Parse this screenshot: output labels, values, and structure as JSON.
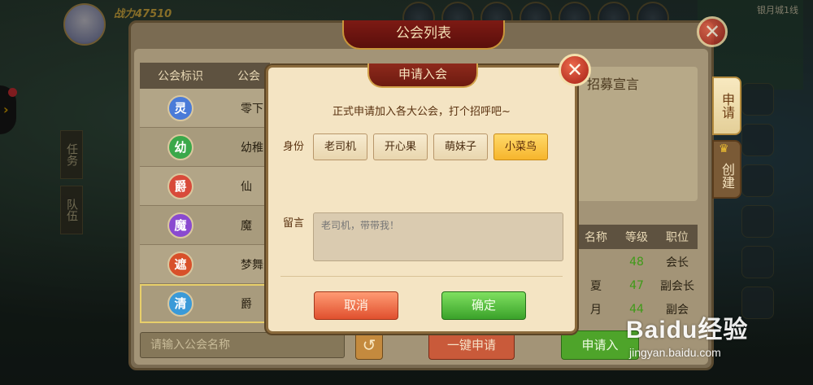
{
  "hud": {
    "power": "战力47510",
    "map_label": "银月城1线"
  },
  "side_tabs": [
    "任务",
    "队伍"
  ],
  "guild_panel": {
    "title": "公会列表",
    "columns": [
      "公会标识",
      "公会"
    ],
    "rows": [
      {
        "emblem": "灵",
        "color": "#4a7bd8",
        "name": "零下"
      },
      {
        "emblem": "幼",
        "color": "#3aa84a",
        "name": "幼稚"
      },
      {
        "emblem": "爵",
        "color": "#d84a3a",
        "name": "仙"
      },
      {
        "emblem": "魔",
        "color": "#8a4ad0",
        "name": "魔"
      },
      {
        "emblem": "遮",
        "color": "#d8502a",
        "name": "梦舞"
      },
      {
        "emblem": "清",
        "color": "#3a9ad8",
        "name": "爵"
      }
    ],
    "search_placeholder": "请输入公会名称",
    "quick_apply": "一键申请",
    "recruit_title": "招募宣言",
    "member_columns": [
      "名称",
      "等级",
      "职位"
    ],
    "members": [
      {
        "name": "",
        "level": "48",
        "role": "会长"
      },
      {
        "name": "夏",
        "level": "47",
        "role": "副会长"
      },
      {
        "name": "月",
        "level": "44",
        "role": "副会"
      }
    ],
    "apply_in": "申请入",
    "tab_apply": "申请",
    "tab_create": "创建"
  },
  "dialog": {
    "title": "申请入会",
    "subtitle": "正式申请加入各大公会，打个招呼吧~",
    "role_label": "身份",
    "roles": [
      "老司机",
      "开心果",
      "萌妹子",
      "小菜鸟"
    ],
    "selected_role": "小菜鸟",
    "message_label": "留言",
    "message_placeholder": "老司机，带带我！",
    "cancel": "取消",
    "confirm": "确定"
  },
  "watermark": {
    "brand": "Baidu经验",
    "url": "jingyan.baidu.com"
  }
}
